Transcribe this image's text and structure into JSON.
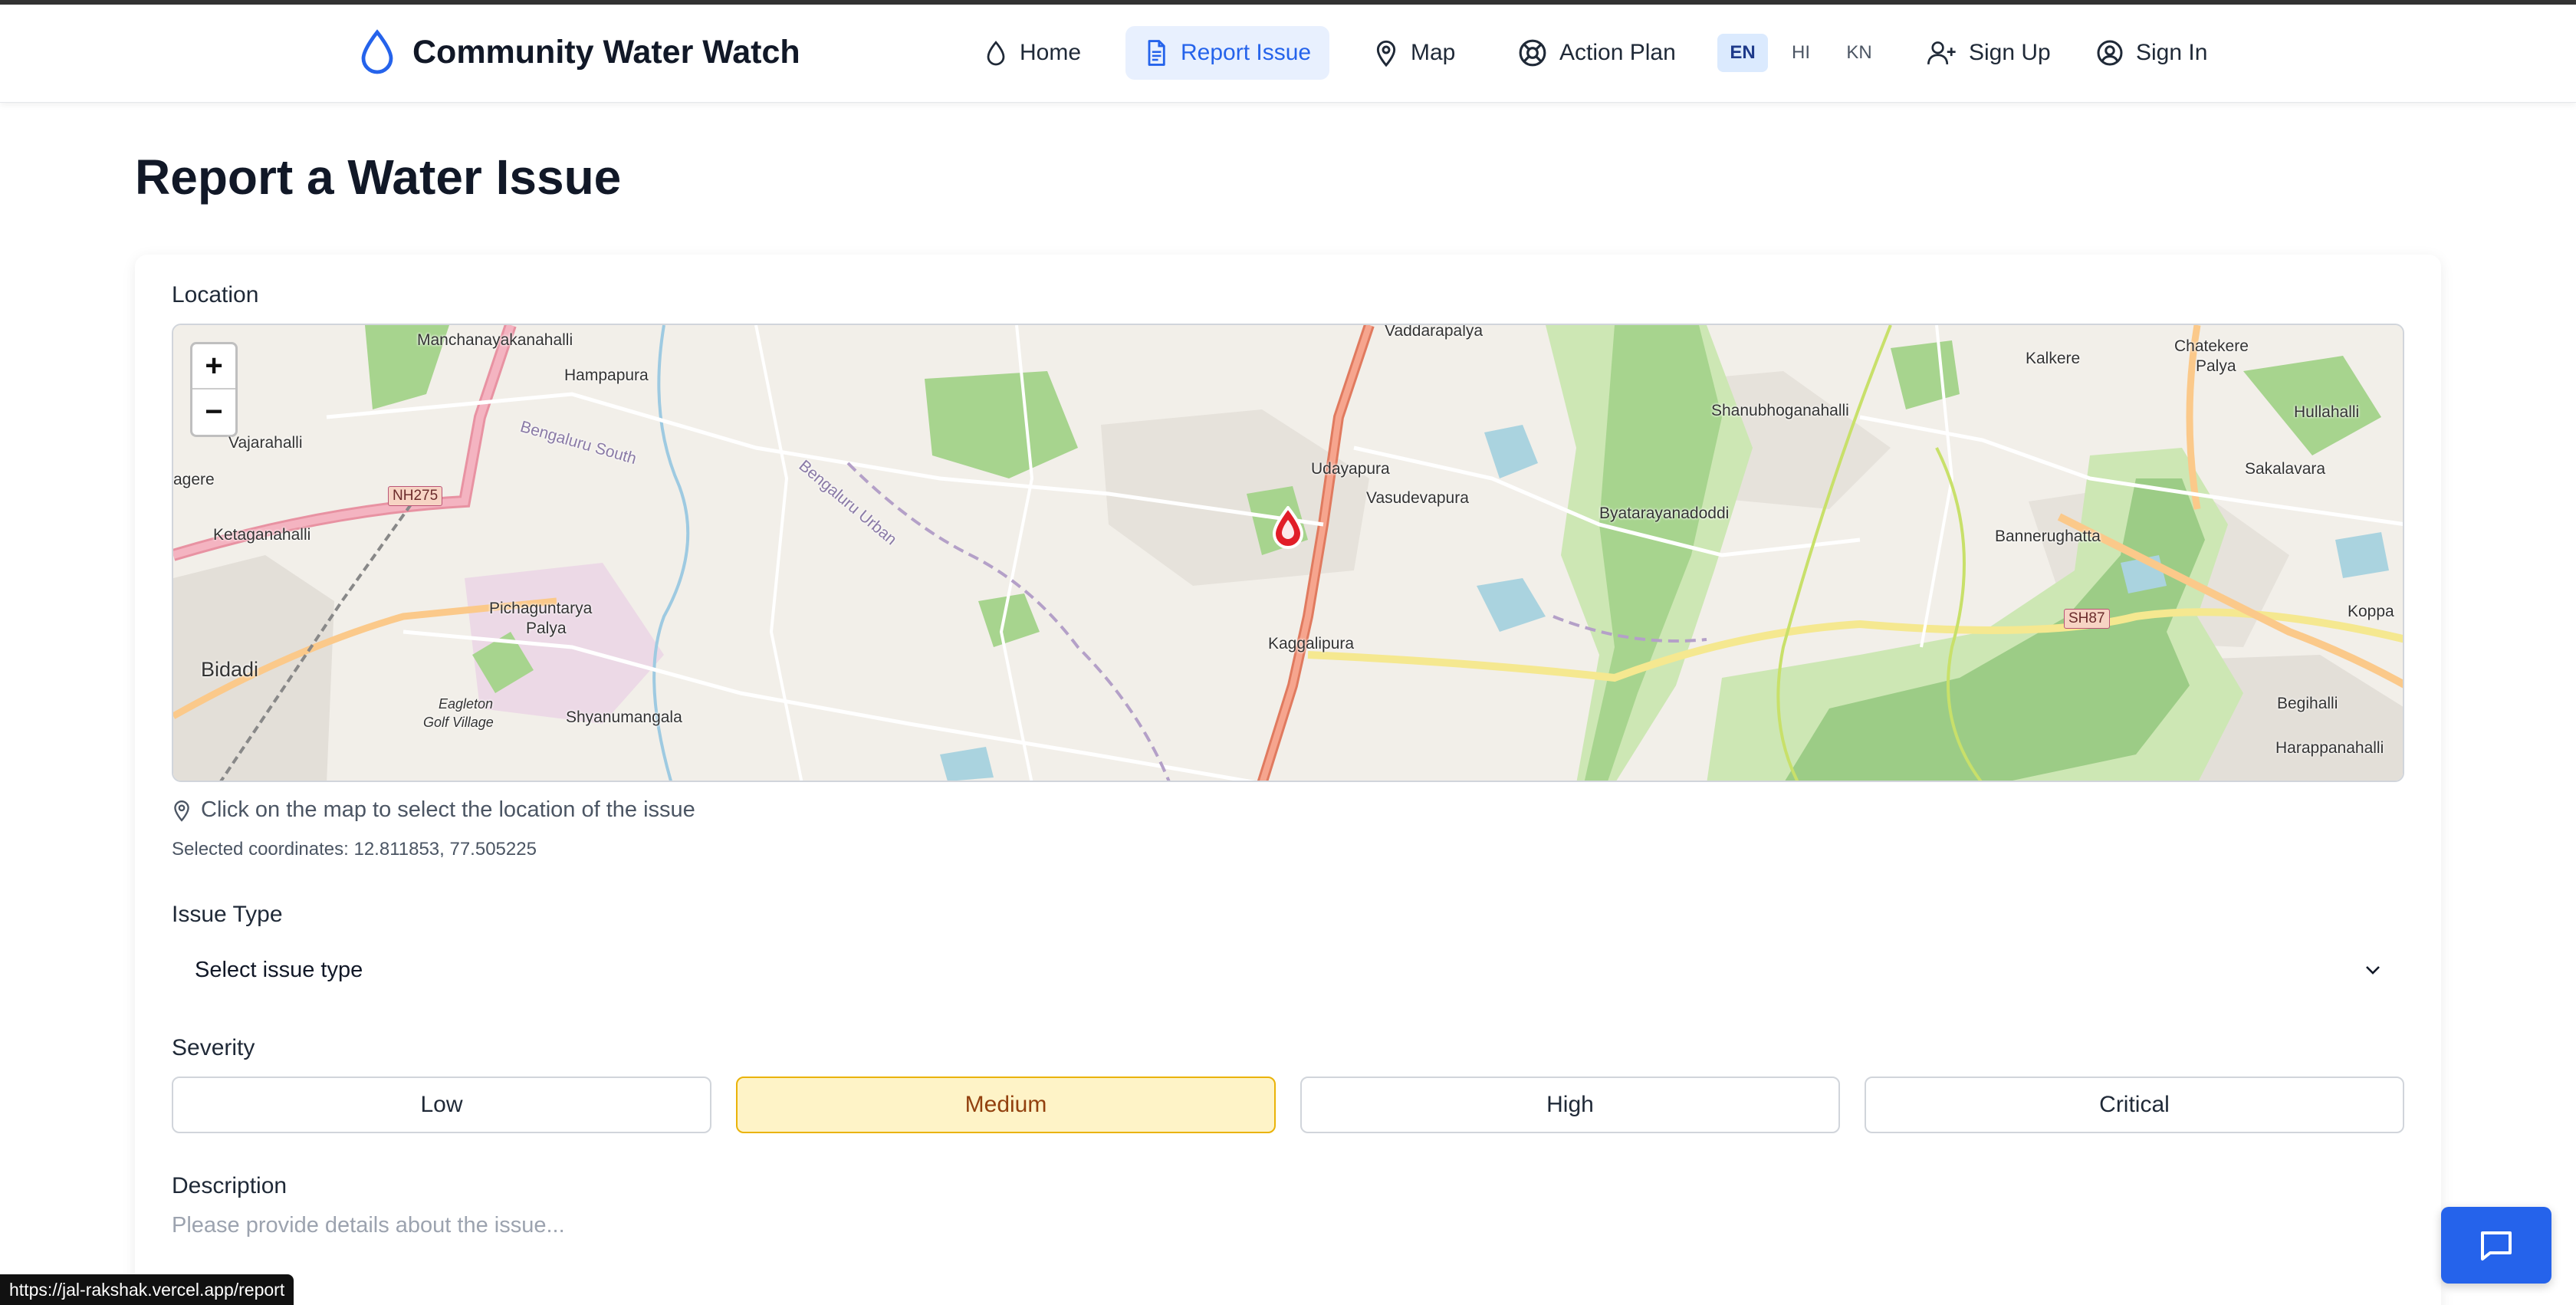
{
  "app": {
    "brand": "Community Water Watch",
    "accent_color": "#2563eb"
  },
  "nav": {
    "home": "Home",
    "report_issue": "Report Issue",
    "map": "Map",
    "action_plan": "Action Plan",
    "languages": [
      "EN",
      "HI",
      "KN"
    ],
    "active_language": "EN",
    "sign_up": "Sign Up",
    "sign_in": "Sign In"
  },
  "page": {
    "title": "Report a Water Issue"
  },
  "location": {
    "label": "Location",
    "hint": "Click on the map to select the location of the issue",
    "coords": "Selected coordinates: 12.811853, 77.505225",
    "map": {
      "zoom_in": "+",
      "zoom_out": "−",
      "marker_icon": "water-drop-marker",
      "places": {
        "manchanayakanahalli": "Manchanayakanahalli",
        "hampapura": "Hampapura",
        "vajarahalli": "Vajarahalli",
        "agere": "agere",
        "ketaganahalli": "Ketaganahalli",
        "bidadi": "Bidadi",
        "pichaguntarya": "Pichaguntarya",
        "palya": "Palya",
        "eagleton": "Eagleton",
        "golf_village": "Golf Village",
        "shyanumangala": "Shyanumangala",
        "bengaluru_south": "Bengaluru South",
        "bengaluru_urban": "Bengaluru Urban",
        "vaddarapalya": "Vaddarapalya",
        "udayapura": "Udayapura",
        "vasudevapura": "Vasudevapura",
        "kaggalipura": "Kaggalipura",
        "byatarayanadoddi": "Byatarayanadoddi",
        "shanubhoganahalli": "Shanubhoganahalli",
        "kalkere": "Kalkere",
        "chatekere": "Chatekere",
        "chatekere_palya": "Palya",
        "hullahalli": "Hullahalli",
        "sakalavara": "Sakalavara",
        "bannerughatta": "Bannerughatta",
        "koppa": "Koppa",
        "begihalli": "Begihalli",
        "harappanahalli": "Harappanahalli",
        "nh275": "NH275",
        "sh87": "SH87"
      }
    }
  },
  "issue_type": {
    "label": "Issue Type",
    "selected": "Select issue type"
  },
  "severity": {
    "label": "Severity",
    "options": [
      "Low",
      "Medium",
      "High",
      "Critical"
    ],
    "selected": "Medium",
    "selected_bg": "#fef3c7"
  },
  "description": {
    "label": "Description",
    "placeholder": "Please provide details about the issue..."
  },
  "status_bar": {
    "url": "https://jal-rakshak.vercel.app/report"
  }
}
